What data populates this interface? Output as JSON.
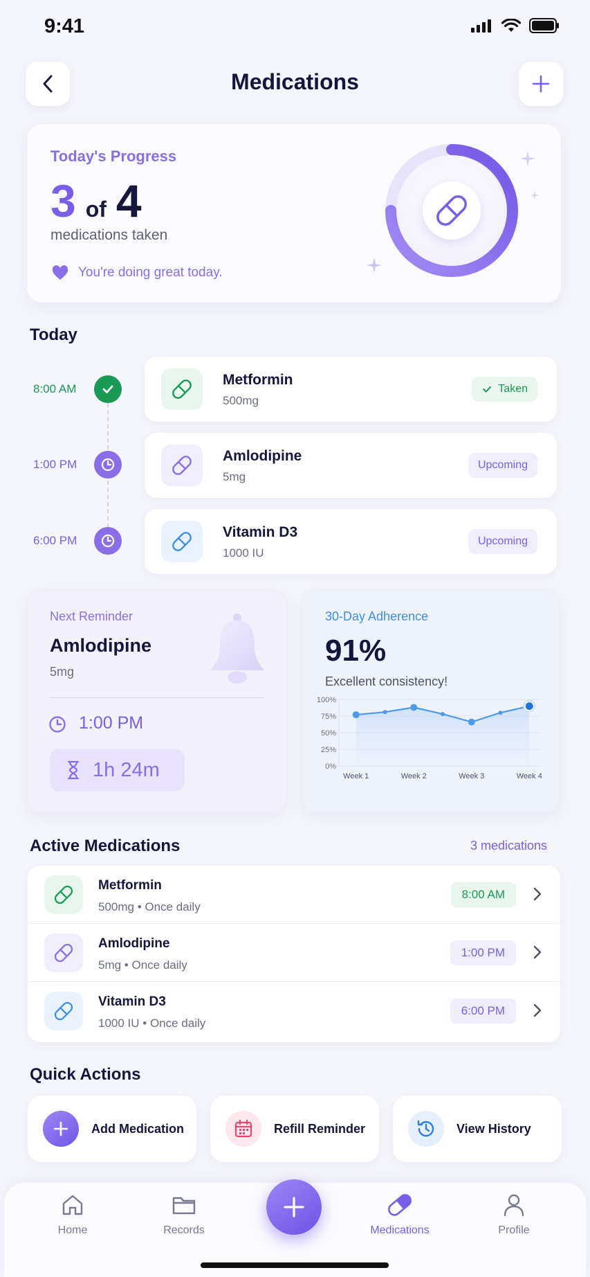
{
  "status_bar": {
    "time": "9:41"
  },
  "header": {
    "title": "Medications"
  },
  "progress": {
    "label": "Today's Progress",
    "taken": "3",
    "of_word": "of",
    "total": "4",
    "subtitle": "medications taken",
    "message": "You're doing great today.",
    "fraction": 0.75
  },
  "today": {
    "title": "Today",
    "items": [
      {
        "time": "8:00 AM",
        "name": "Metformin",
        "dose": "500mg",
        "status": "Taken"
      },
      {
        "time": "1:00 PM",
        "name": "Amlodipine",
        "dose": "5mg",
        "status": "Upcoming"
      },
      {
        "time": "6:00 PM",
        "name": "Vitamin D3",
        "dose": "1000 IU",
        "status": "Upcoming"
      }
    ]
  },
  "reminder": {
    "label": "Next Reminder",
    "name": "Amlodipine",
    "dose": "5mg",
    "time": "1:00 PM",
    "countdown": "1h 24m"
  },
  "adherence": {
    "label": "30-Day Adherence",
    "value": "91%",
    "note": "Excellent consistency!"
  },
  "chart_data": {
    "type": "line",
    "x": [
      "Week 1",
      "Week 2",
      "Week 3",
      "Week 4"
    ],
    "ytick_labels": [
      "100%",
      "75%",
      "50%",
      "25%",
      "0%"
    ],
    "ylim": [
      0,
      100
    ],
    "points": [
      {
        "x": 1.0,
        "y": 77
      },
      {
        "x": 1.5,
        "y": 81
      },
      {
        "x": 2.0,
        "y": 88
      },
      {
        "x": 2.5,
        "y": 78
      },
      {
        "x": 3.0,
        "y": 66
      },
      {
        "x": 3.5,
        "y": 80
      },
      {
        "x": 4.0,
        "y": 90
      }
    ],
    "marked_x": [
      1.0,
      2.0,
      3.0,
      4.0
    ],
    "highlight_x": 4.0,
    "grid": true
  },
  "active": {
    "title": "Active Medications",
    "count": "3 medications",
    "items": [
      {
        "name": "Metformin",
        "details": "500mg • Once daily",
        "time": "8:00 AM"
      },
      {
        "name": "Amlodipine",
        "details": "5mg • Once daily",
        "time": "1:00 PM"
      },
      {
        "name": "Vitamin D3",
        "details": "1000 IU • Once daily",
        "time": "6:00 PM"
      }
    ]
  },
  "quick_actions": {
    "title": "Quick Actions",
    "add": "Add Medication",
    "refill": "Refill Reminder",
    "history": "View History"
  },
  "nav": {
    "home": "Home",
    "records": "Records",
    "medications": "Medications",
    "profile": "Profile",
    "active_color": "#7b5ee8"
  },
  "colors": {
    "accent": "#7b5ee8",
    "green": "#1a9a55",
    "blue": "#3d8fe6"
  }
}
